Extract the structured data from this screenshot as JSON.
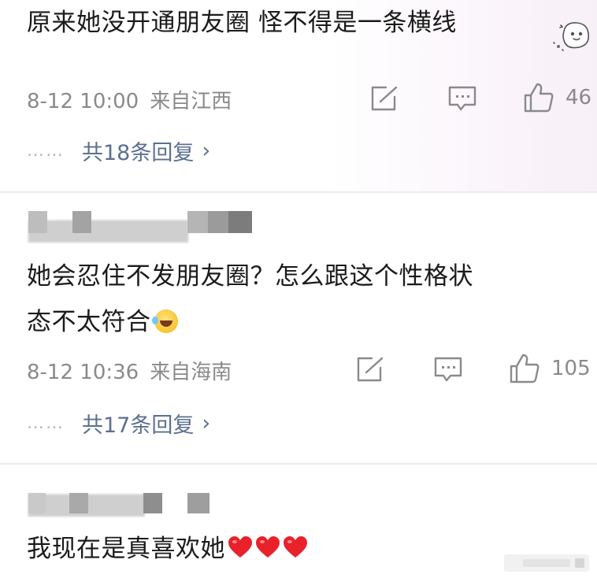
{
  "comments": [
    {
      "text": "原来她没开通朋友圈 怪不得是一条横线",
      "date": "8-12 10:00",
      "location": "来自江西",
      "likes": "46",
      "replies": "共18条回复",
      "reply_dots": "……",
      "reply_chevron": "›"
    },
    {
      "text_line1": "她会忍住不发朋友圈？怎么跟这个性格状",
      "text_line2": "态不太符合",
      "date": "8-12 10:36",
      "location": "来自海南",
      "likes": "105",
      "replies": "共17条回复",
      "reply_dots": "……",
      "reply_chevron": "›"
    },
    {
      "text": "我现在是真喜欢她"
    }
  ],
  "icons": {
    "share": "share-icon",
    "comment": "comment-icon",
    "like": "thumbs-up-icon",
    "laugh_emoji": "laughing-crying-emoji-icon",
    "heart_emoji": "red-heart-icon",
    "sticker": "cute-sticker-icon"
  },
  "colors": {
    "text": "#1b1b1b",
    "meta": "#8a8a8a",
    "reply_link": "#5c6f8f",
    "divider": "#ececec",
    "heart": "#e8212b"
  }
}
